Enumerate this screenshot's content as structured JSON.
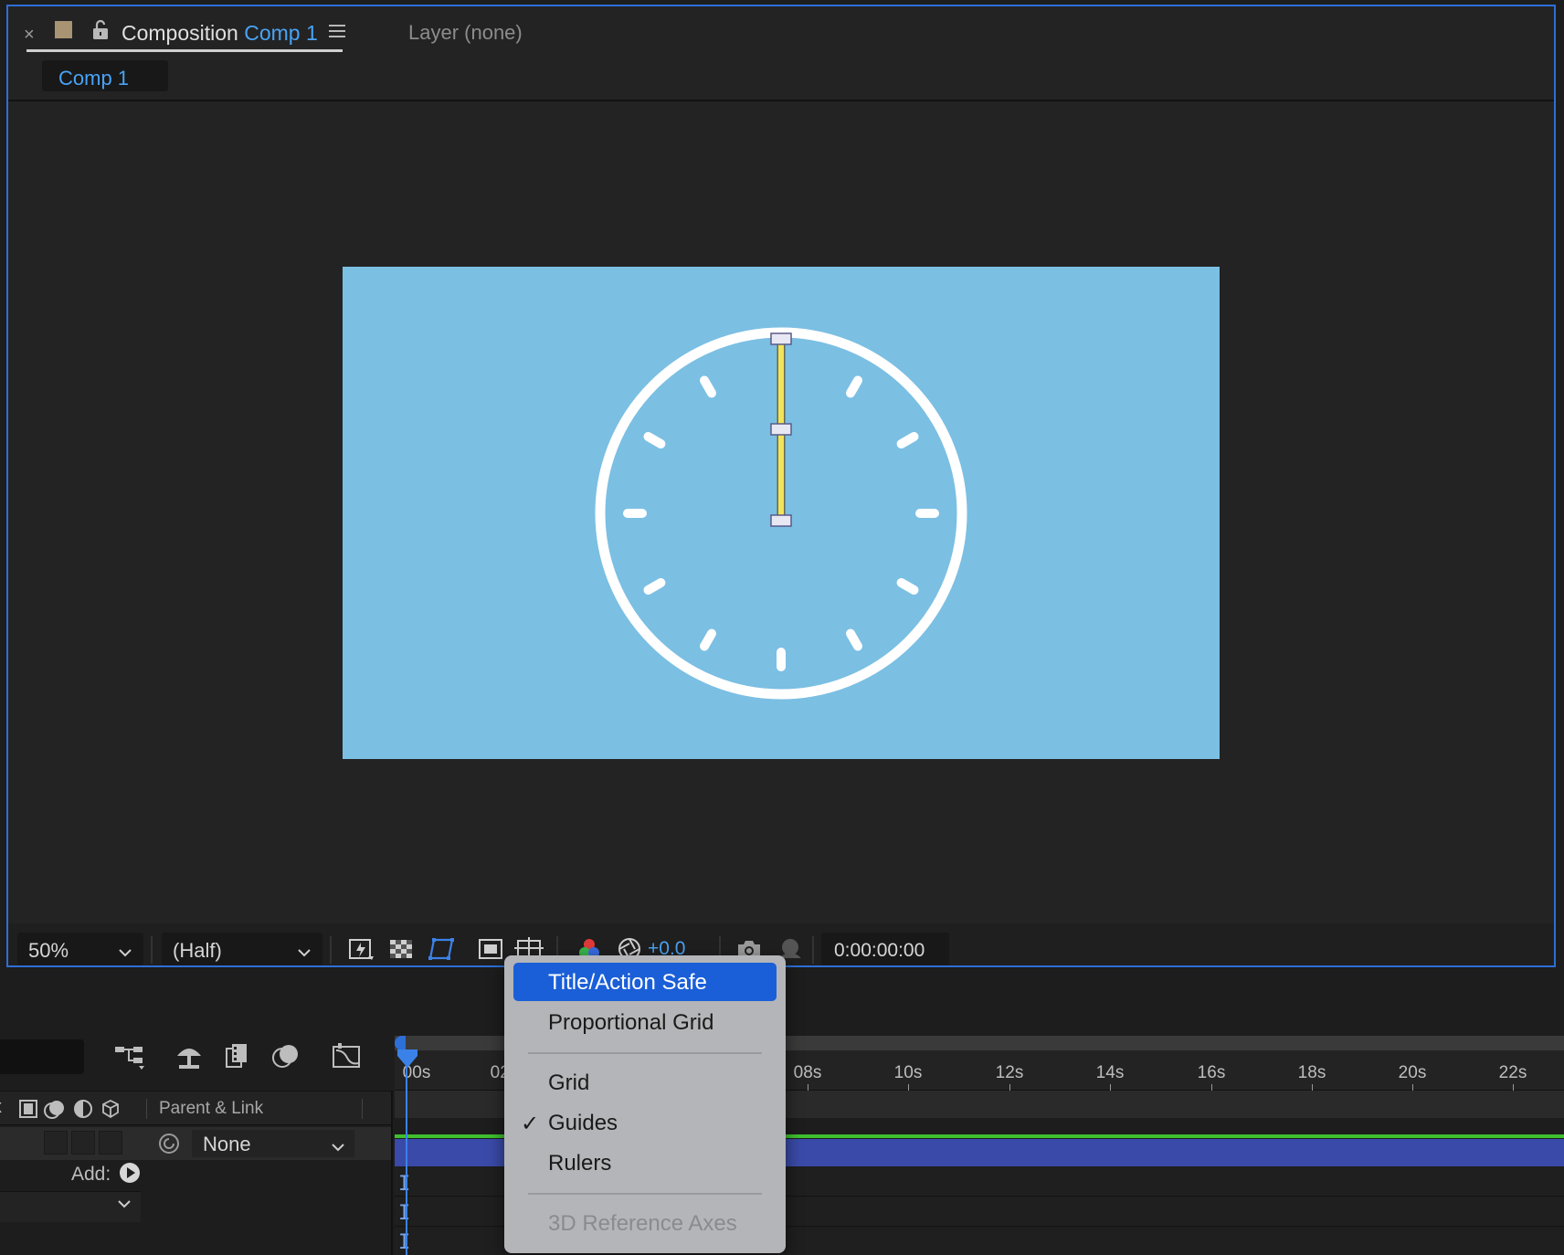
{
  "panel": {
    "close_glyph": "×",
    "tab_prefix": "Composition",
    "tab_comp_name": "Comp 1",
    "layer_tab": "Layer (none)",
    "breadcrumb": "Comp 1",
    "swatch_color": "#a89373",
    "accent_color": "#2d6fd6"
  },
  "canvas": {
    "background_color": "#7bbfe3",
    "clock_color": "#ffffff",
    "hand_color": "#f2e35a"
  },
  "toolbar": {
    "zoom": "50%",
    "resolution": "(Half)",
    "exposure": "+0.0",
    "timecode": "0:00:00:00",
    "icons": [
      "fast-preview-icon",
      "transparency-grid-icon",
      "mask-path-visibility-icon",
      "region-of-interest-icon",
      "grid-guide-options-icon",
      "color-channels-icon",
      "exposure-reset-icon",
      "snapshot-camera-icon",
      "show-snapshot-icon"
    ]
  },
  "timeline": {
    "parent_link_header": "Parent & Link",
    "parent_value": "None",
    "add_label": "Add:",
    "ruler_labels": [
      "00s",
      "02s",
      "08s",
      "10s",
      "12s",
      "14s",
      "16s",
      "18s",
      "20s",
      "22s"
    ],
    "track_matte_color": "#3fbf2f",
    "layer_bar_color": "#3a4aa8"
  },
  "menu": {
    "items": [
      {
        "label": "Title/Action Safe",
        "state": "highlighted"
      },
      {
        "label": "Proportional Grid",
        "state": "normal"
      },
      {
        "label": "Grid",
        "state": "normal"
      },
      {
        "label": "Guides",
        "state": "checked"
      },
      {
        "label": "Rulers",
        "state": "normal"
      },
      {
        "label": "3D Reference Axes",
        "state": "disabled"
      }
    ],
    "check_glyph": "✓",
    "highlight_color": "#1a5fd8"
  }
}
